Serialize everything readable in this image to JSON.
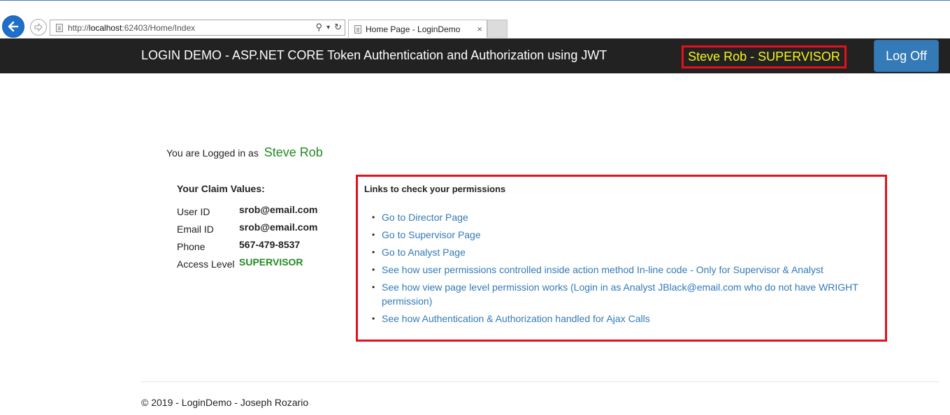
{
  "browser": {
    "url_prefix": "http://",
    "url_host": "localhost",
    "url_rest": ":62403/Home/Index",
    "tab_title": "Home Page - LoginDemo",
    "tab_close": "×",
    "search_glyph": "⚲",
    "dropdown_glyph": "▾",
    "refresh_glyph": "↻"
  },
  "navbar": {
    "brand": "LOGIN DEMO - ASP.NET CORE Token Authentication and Authorization using JWT",
    "user_badge": "Steve Rob - SUPERVISOR",
    "logoff_label": "Log Off"
  },
  "main": {
    "logged_in_prefix": "You are Logged in as",
    "logged_in_name": "Steve Rob",
    "claims_heading": "Your Claim Values:",
    "claims": [
      {
        "label": "User ID",
        "value": "srob@email.com"
      },
      {
        "label": "Email ID",
        "value": "srob@email.com"
      },
      {
        "label": "Phone",
        "value": "567-479-8537"
      },
      {
        "label": "Access Level",
        "value": "SUPERVISOR"
      }
    ],
    "permissions_heading": "Links to check your permissions",
    "permission_links": [
      "Go to Director Page",
      "Go to Supervisor Page",
      "Go to Analyst Page",
      "See how user permissions controlled inside action method In-line code - Only for Supervisor & Analyst",
      "See how view page level permission works (Login in as Analyst JBlack@email.com who do not have WRIGHT permission)",
      "See how Authentication & Authorization handled for Ajax Calls"
    ]
  },
  "footer": {
    "text": "© 2019 - LoginDemo - Joseph Rozario"
  },
  "colors": {
    "navbar_bg": "#222222",
    "badge_border": "#e3111c",
    "badge_text": "#f6f51b",
    "button_bg": "#337ab7",
    "link": "#337ab7",
    "name_green": "#228b22"
  },
  "icons": [
    "back-arrow-icon",
    "forward-arrow-icon",
    "page-icon",
    "search-icon",
    "dropdown-icon",
    "refresh-icon",
    "close-icon"
  ]
}
